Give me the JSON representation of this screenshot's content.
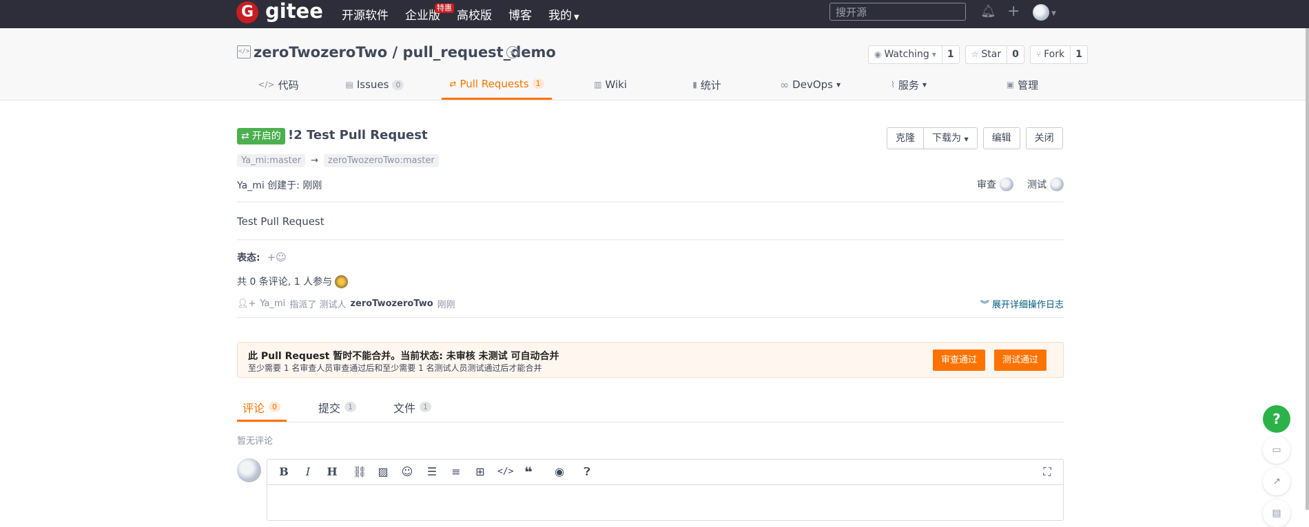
{
  "top_nav": {
    "logo_mark": "G",
    "logo_text": "gitee",
    "links": [
      {
        "label": "开源软件"
      },
      {
        "label": "企业版",
        "badge": "特惠"
      },
      {
        "label": "高校版"
      },
      {
        "label": "博客"
      },
      {
        "label": "我的"
      }
    ],
    "search_placeholder": "搜开源",
    "icons": [
      "bell-icon",
      "plus-icon",
      "avatar"
    ]
  },
  "repo": {
    "title": "zeroTwozeroTwo / pull_request_demo",
    "watch_label": "Watching",
    "watch_count": "1",
    "star_label": "Star",
    "star_count": "0",
    "fork_label": "Fork",
    "fork_count": "1",
    "tabs": [
      {
        "label": "代码",
        "icon": "code-icon"
      },
      {
        "label": "Issues",
        "count": "0",
        "icon": "issues-icon"
      },
      {
        "label": "Pull Requests",
        "count": "1",
        "icon": "pull-request-icon",
        "active": true
      },
      {
        "label": "Wiki",
        "icon": "book-icon"
      },
      {
        "label": "统计",
        "icon": "chart-icon"
      },
      {
        "label": "DevOps",
        "icon": "infinity-icon"
      },
      {
        "label": "服务",
        "icon": "pulse-icon"
      },
      {
        "label": "管理",
        "icon": "settings-doc-icon"
      }
    ]
  },
  "pr": {
    "state": "开启的",
    "title": "!2 Test Pull Request",
    "buttons": {
      "clone": "克隆",
      "download": "下载为",
      "edit": "编辑",
      "close": "关闭"
    },
    "source_branch": "Ya_mi:master",
    "arrow": "→",
    "target_branch": "zeroTwozeroTwo:master",
    "author": "Ya_mi",
    "created_label": "创建于:",
    "created_time": "刚刚",
    "reviewer_label": "审查",
    "tester_label": "测试",
    "body": "Test Pull Request",
    "reactions_label": "表态:",
    "participation": "共 0 条评论, 1 人参与",
    "activity": {
      "actor": "Ya_mi",
      "action": "指派了 测试人",
      "target": "zeroTwozeroTwo",
      "time": "刚刚"
    },
    "expand_log": "展开详细操作日志"
  },
  "merge": {
    "title": "此 Pull Request 暂时不能合并。当前状态: 未审核 未测试 可自动合并",
    "subtitle": "至少需要 1 名审查人员审查通过后和至少需要 1 名测试人员测试通过后才能合并",
    "review_pass": "审查通过",
    "test_pass": "测试通过"
  },
  "discussion": {
    "tabs": [
      {
        "label": "评论",
        "count": "0",
        "active": true
      },
      {
        "label": "提交",
        "count": "1"
      },
      {
        "label": "文件",
        "count": "1"
      }
    ],
    "empty": "暂无评论"
  },
  "editor": {
    "tools": [
      "bold-icon",
      "italic-icon",
      "heading-icon",
      "link-icon",
      "image-icon",
      "emoji-icon",
      "bullet-list-icon",
      "ordered-list-icon",
      "table-icon",
      "code-icon",
      "quote-icon",
      "preview-icon",
      "help-icon",
      "fullscreen-icon"
    ]
  },
  "colors": {
    "accent": "#fe7300",
    "nav_bg": "#2d2e3a",
    "open_badge": "#4caf50",
    "help_button": "#2bb349"
  }
}
